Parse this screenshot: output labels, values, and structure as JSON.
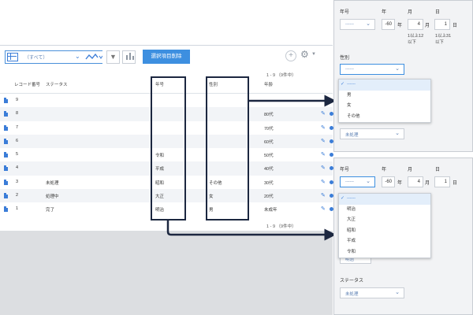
{
  "list": {
    "view_label": "（すべて）",
    "bulk_button": "選択項目削除",
    "pager_top": "1 - 9 （9件中）",
    "pager_bottom": "1 - 9 （9件中）",
    "columns": {
      "record_no": "レコード番号",
      "status": "ステータス",
      "era": "年号",
      "gender": "性別",
      "age": "年齢"
    },
    "rows": [
      {
        "record_no": "9",
        "status": "",
        "era": "",
        "gender": "",
        "age": ""
      },
      {
        "record_no": "8",
        "status": "",
        "era": "",
        "gender": "",
        "age": "80代"
      },
      {
        "record_no": "7",
        "status": "",
        "era": "",
        "gender": "",
        "age": "70代"
      },
      {
        "record_no": "6",
        "status": "",
        "era": "",
        "gender": "",
        "age": "60代"
      },
      {
        "record_no": "5",
        "status": "",
        "era": "令和",
        "gender": "",
        "age": "50代"
      },
      {
        "record_no": "4",
        "status": "",
        "era": "平成",
        "gender": "",
        "age": "40代"
      },
      {
        "record_no": "3",
        "status": "未処理",
        "era": "昭和",
        "gender": "その他",
        "age": "30代"
      },
      {
        "record_no": "2",
        "status": "処理中",
        "era": "大正",
        "gender": "女",
        "age": "20代"
      },
      {
        "record_no": "1",
        "status": "完了",
        "era": "明治",
        "gender": "男",
        "age": "未成年"
      }
    ]
  },
  "form_top": {
    "era_label": "年号",
    "year_label": "年",
    "month_label": "月",
    "day_label": "日",
    "era_value": "------",
    "year_value": "-60",
    "year_unit": "年",
    "month_value": "4",
    "month_unit": "月",
    "day_value": "1",
    "day_unit": "日",
    "month_hint_1": "1以上12",
    "month_hint_2": "以下",
    "day_hint_1": "1以上31",
    "day_hint_2": "以下",
    "gender_label": "性別",
    "gender_value": "------",
    "gender_options": [
      "------",
      "男",
      "女",
      "その他"
    ],
    "status_value": "未処理"
  },
  "form_bottom": {
    "era_label": "年号",
    "year_label": "年",
    "month_label": "月",
    "day_label": "日",
    "era_value": "------",
    "year_value": "-60",
    "year_unit": "年",
    "month_value": "4",
    "month_unit": "月",
    "day_value": "1",
    "day_unit": "日",
    "era_options": [
      "------",
      "明治",
      "大正",
      "昭和",
      "平成",
      "令和"
    ],
    "hidden_field_value": "明治",
    "status_label": "ステータス",
    "status_value": "未処理"
  },
  "colors": {
    "accent": "#3d8fe0",
    "highlight_border": "#1c2740",
    "footer_gray": "#dcdee1"
  }
}
